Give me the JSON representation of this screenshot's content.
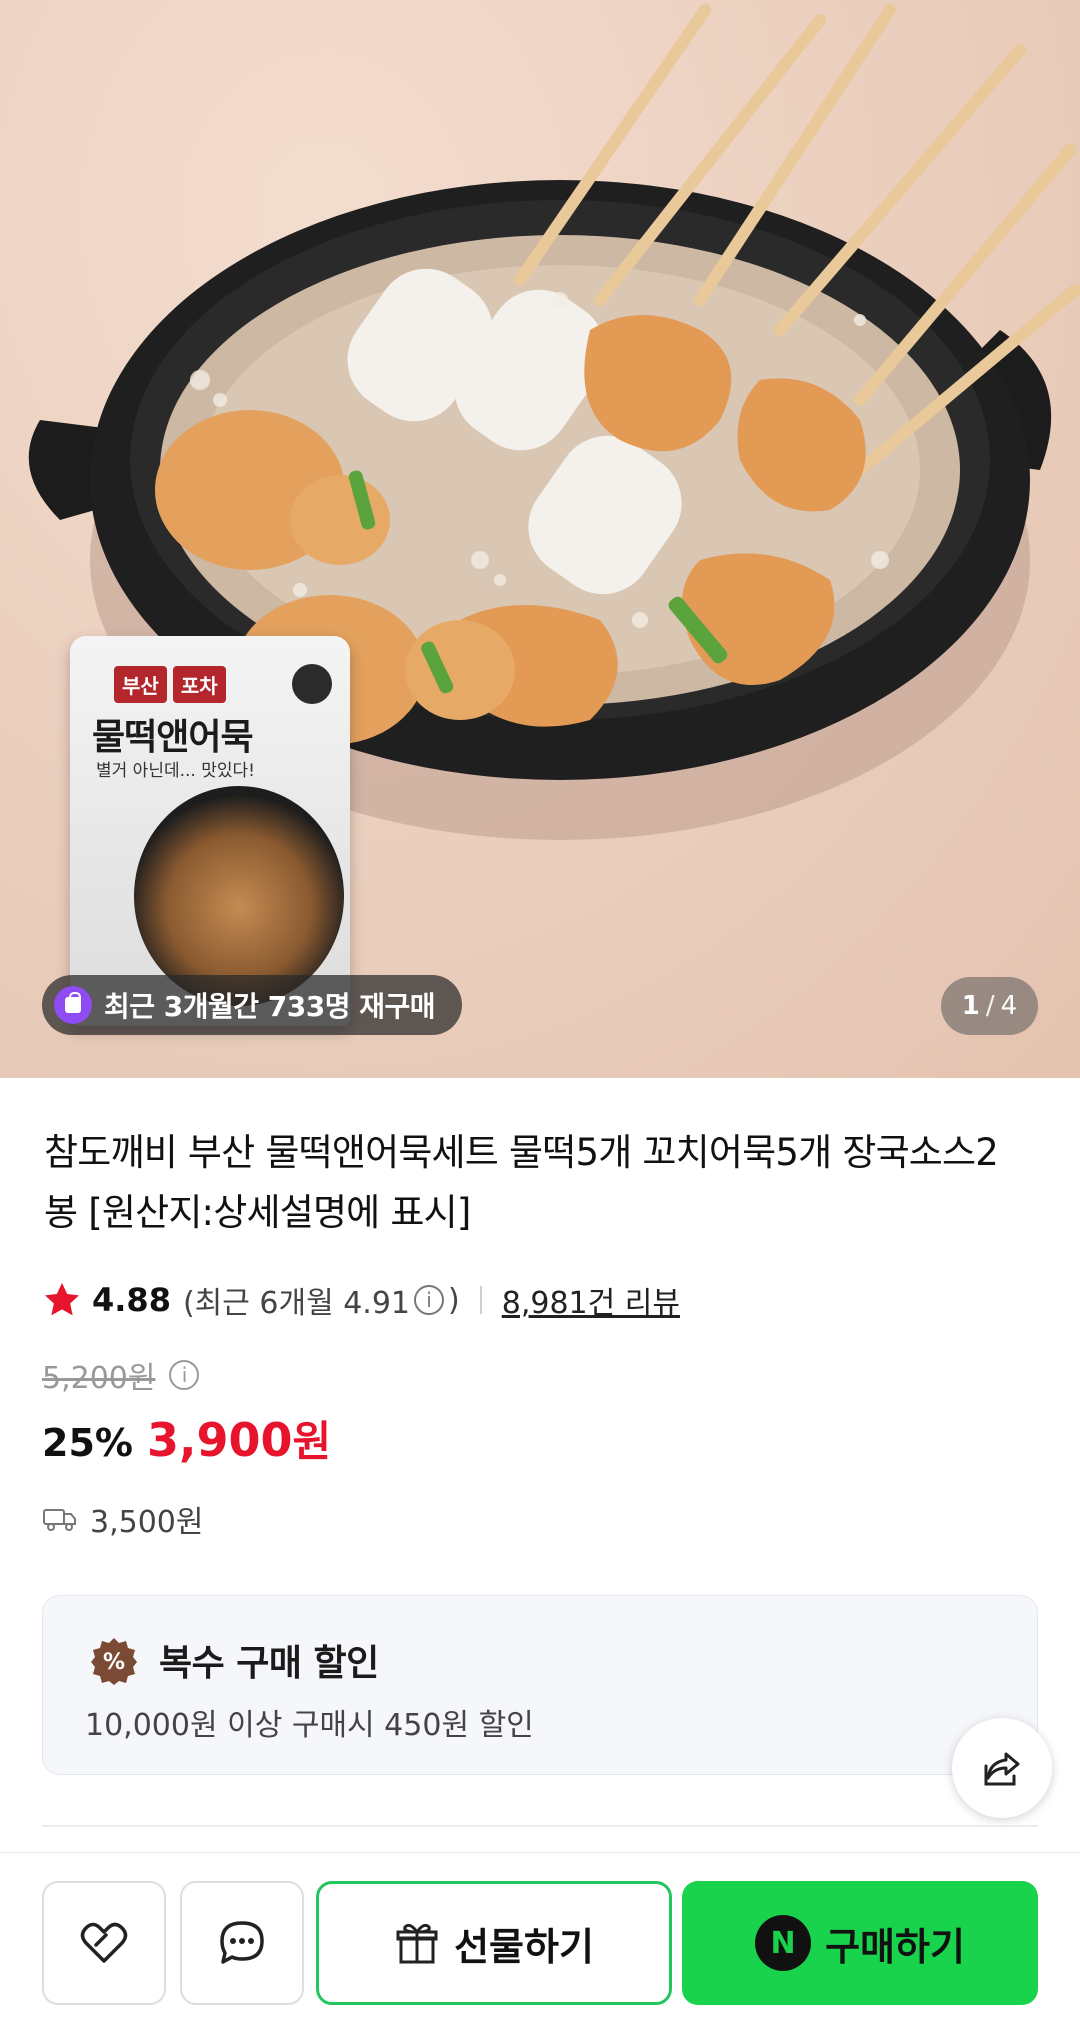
{
  "hero": {
    "package": {
      "brand_left": "부산",
      "brand_right": "포차",
      "title": "물떡앤어묵",
      "subtitle": "별거 아닌데... 맛있다!"
    },
    "repurchase_badge": "최근 3개월간 733명 재구매",
    "pager": {
      "current": "1",
      "separator": "/",
      "total": "4"
    }
  },
  "product": {
    "title": "참도깨비 부산 물떡앤어묵세트 물떡5개 꼬치어묵5개 장국소스2봉 [원산지:상세설명에 표시]",
    "rating": "4.88",
    "recent_rating_label": "(최근 6개월 4.91",
    "recent_rating_close": ")",
    "review_count": "8,981건 리뷰",
    "original_price": "5,200원",
    "discount": "25%",
    "sale_price": "3,900",
    "sale_price_unit": "원",
    "shipping_fee": "3,500원"
  },
  "promo": {
    "icon": "%",
    "title": "복수 구매 할인",
    "description": "10,000원 이상 구매시 450원 할인"
  },
  "bottom_bar": {
    "gift_label": "선물하기",
    "buy_logo": "N",
    "buy_label": "구매하기"
  },
  "colors": {
    "sale_red": "#e8132c",
    "buy_green": "#19d34c",
    "gift_border": "#22c55e",
    "badge_purple": "#8f4cf2"
  },
  "icons": [
    "repurchase-bag-icon",
    "info-icon",
    "star-icon",
    "truck-icon",
    "discount-badge-icon",
    "share-icon",
    "wishlist-heart-icon",
    "chat-bubble-icon",
    "gift-icon",
    "naver-pay-icon"
  ]
}
